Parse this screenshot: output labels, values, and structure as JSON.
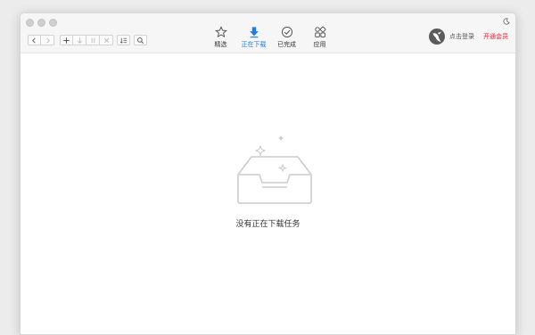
{
  "toolbar": {
    "buttons": [
      "back-icon",
      "forward-icon",
      "add-icon",
      "download-icon",
      "pause-icon",
      "close-icon",
      "sort-icon",
      "search-icon"
    ]
  },
  "tabs": [
    {
      "label": "精选",
      "icon": "star-icon",
      "active": false
    },
    {
      "label": "正在下载",
      "icon": "download-arrow-icon",
      "active": true
    },
    {
      "label": "已完成",
      "icon": "check-circle-icon",
      "active": false
    },
    {
      "label": "应用",
      "icon": "apps-grid-icon",
      "active": false
    }
  ],
  "user": {
    "login_label": "点击登录",
    "vip_label": "开通会员"
  },
  "empty_state": {
    "message": "没有正在下载任务"
  },
  "colors": {
    "accent": "#1e7ae6",
    "vip": "#e8192c"
  }
}
